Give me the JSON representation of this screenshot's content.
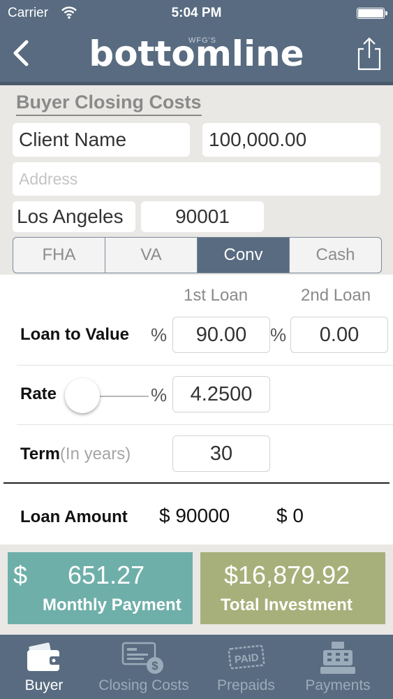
{
  "status_bar": {
    "carrier": "Carrier",
    "time": "5:04 PM"
  },
  "nav": {
    "brand_super": "WFG'S",
    "brand": "bottomline"
  },
  "section_title": "Buyer Closing Costs",
  "form": {
    "client_name": "Client Name",
    "price": "100,000.00",
    "address_placeholder": "Address",
    "city": "Los Angeles",
    "zip": "90001"
  },
  "loan_types": [
    {
      "label": "FHA",
      "active": false
    },
    {
      "label": "VA",
      "active": false
    },
    {
      "label": "Conv",
      "active": true
    },
    {
      "label": "Cash",
      "active": false
    }
  ],
  "loan": {
    "col_first": "1st Loan",
    "col_second": "2nd Loan",
    "ltv_label": "Loan to Value",
    "pct_symbol": "%",
    "ltv_first": "90.00",
    "ltv_second": "0.00",
    "rate_label": "Rate",
    "rate": "4.2500",
    "rate_slider_level": 0.0,
    "term_label": "Term",
    "term_hint": "(In years)",
    "term": "30",
    "amount_label": "Loan Amount",
    "amount_first": "$ 90000",
    "amount_second": "$ 0"
  },
  "summary": {
    "monthly_symbol": "$",
    "monthly_value": "651.27",
    "monthly_label": "Monthly Payment",
    "total_value": "$16,879.92",
    "total_label": "Total Investment"
  },
  "tabs": [
    {
      "label": "Buyer",
      "icon": "wallet-icon",
      "active": true
    },
    {
      "label": "Closing Costs",
      "icon": "check-dollar-icon",
      "active": false
    },
    {
      "label": "Prepaids",
      "icon": "paid-stamp-icon",
      "active": false
    },
    {
      "label": "Payments",
      "icon": "cash-register-icon",
      "active": false
    }
  ],
  "colors": {
    "nav": "#586b80",
    "monthly_tile": "#6fafa9",
    "total_tile": "#a7b07a",
    "background": "#e9e8e5"
  },
  "icon_paid_text": "PAID"
}
